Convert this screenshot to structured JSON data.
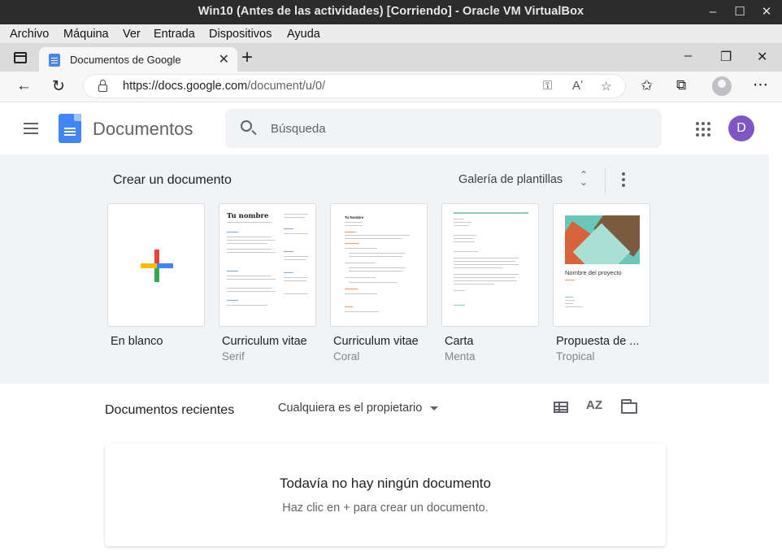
{
  "vbox": {
    "title": "Win10 (Antes de las actividades) [Corriendo] - Oracle VM VirtualBox",
    "menu": [
      "Archivo",
      "Máquina",
      "Ver",
      "Entrada",
      "Dispositivos",
      "Ayuda"
    ]
  },
  "browser": {
    "tab_title": "Documentos de Google",
    "url_domain": "https://docs.google.com",
    "url_path": "/document/u/0/"
  },
  "docs": {
    "app_name": "Documentos",
    "search_placeholder": "Búsqueda",
    "user_initial": "D",
    "user_avatar_color": "#7e57c2",
    "gallery": {
      "title": "Crear un documento",
      "link": "Galería de plantillas",
      "templates": [
        {
          "name": "En blanco",
          "sub": ""
        },
        {
          "name": "Curriculum vitae",
          "sub": "Serif"
        },
        {
          "name": "Curriculum vitae",
          "sub": "Coral"
        },
        {
          "name": "Carta",
          "sub": "Menta"
        },
        {
          "name": "Propuesta de ...",
          "sub": "Tropical"
        }
      ],
      "thumb_text": {
        "serif_name": "Tu nombre",
        "coral_name": "Tu Nombre",
        "tropical_title": "Nombre del proyecto"
      }
    },
    "recent": {
      "title": "Documentos recientes",
      "owner_filter": "Cualquiera es el propietario",
      "sort_icon_text": "AZ",
      "empty_title": "Todavía no hay ningún documento",
      "empty_sub": "Haz clic en + para crear un documento."
    }
  }
}
